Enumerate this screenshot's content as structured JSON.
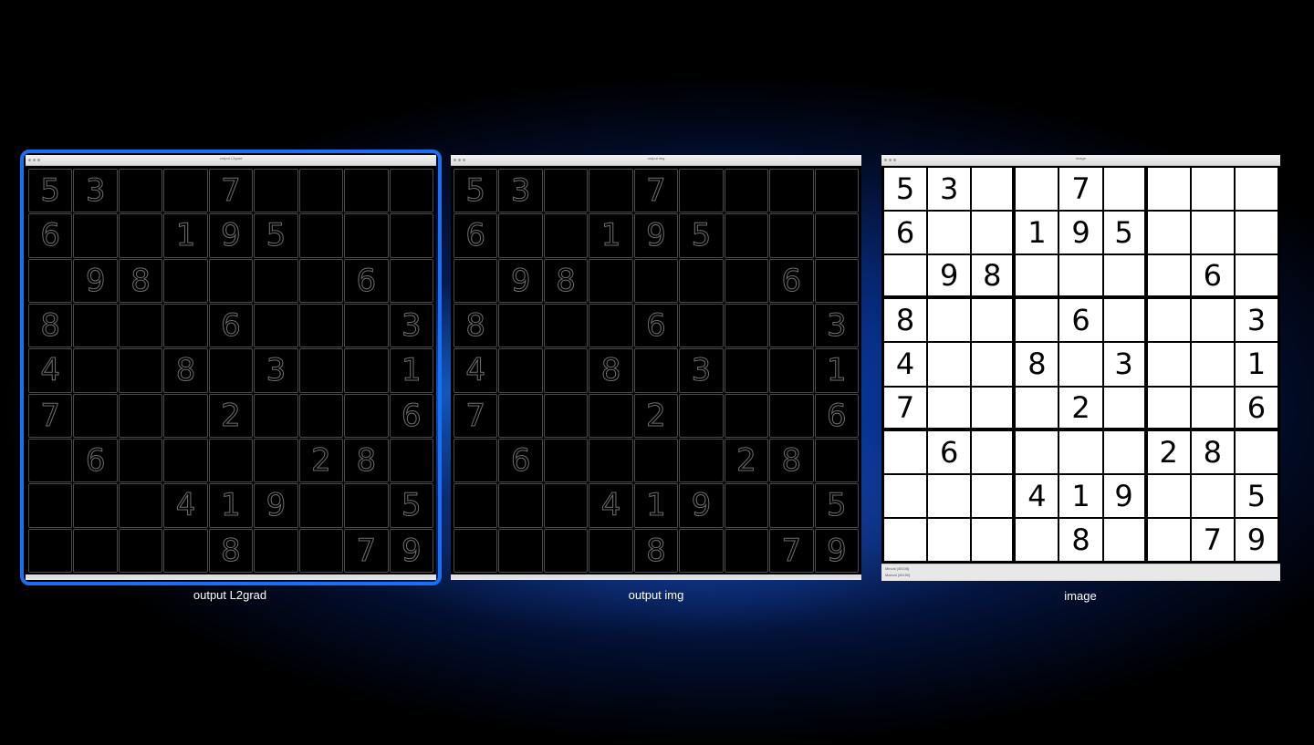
{
  "windows": [
    {
      "caption": "output L2grad",
      "title": "output L2grad",
      "style": "edges",
      "selected": true
    },
    {
      "caption": "output img",
      "title": "output img",
      "style": "edges",
      "selected": false
    },
    {
      "caption": "image",
      "title": "image",
      "style": "source",
      "selected": false,
      "status": [
        "Minval [45108]",
        "Maxval [45150]"
      ]
    }
  ],
  "sudoku": [
    [
      "5",
      "3",
      "",
      "",
      "7",
      "",
      "",
      "",
      ""
    ],
    [
      "6",
      "",
      "",
      "1",
      "9",
      "5",
      "",
      "",
      ""
    ],
    [
      "",
      "9",
      "8",
      "",
      "",
      "",
      "",
      "6",
      ""
    ],
    [
      "8",
      "",
      "",
      "",
      "6",
      "",
      "",
      "",
      "3"
    ],
    [
      "4",
      "",
      "",
      "8",
      "",
      "3",
      "",
      "",
      "1"
    ],
    [
      "7",
      "",
      "",
      "",
      "2",
      "",
      "",
      "",
      "6"
    ],
    [
      "",
      "6",
      "",
      "",
      "",
      "",
      "2",
      "8",
      ""
    ],
    [
      "",
      "",
      "",
      "4",
      "1",
      "9",
      "",
      "",
      "5"
    ],
    [
      "",
      "",
      "",
      "",
      "8",
      "",
      "",
      "7",
      "9"
    ]
  ],
  "colors": {
    "selection_border": "#1a6ff5",
    "desktop_background": "#041a4e"
  }
}
